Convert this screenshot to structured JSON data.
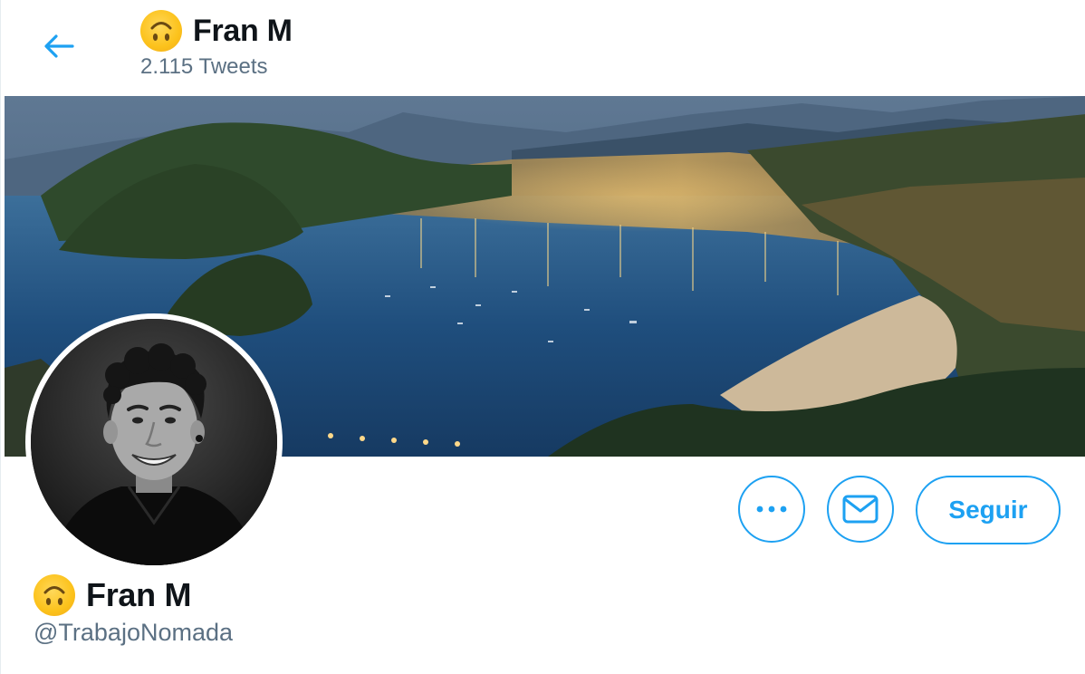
{
  "header": {
    "back_icon": "arrow-left-icon",
    "name": "Fran M",
    "tweet_count": "2.115 Tweets",
    "emoji_icon": "upside-down-face-emoji"
  },
  "banner": {
    "description_icon": "city-bay-night-photo"
  },
  "avatar": {
    "icon": "profile-photo"
  },
  "actions": {
    "more_icon": "more-dots-icon",
    "message_icon": "envelope-icon",
    "follow_label": "Seguir"
  },
  "profile": {
    "name": "Fran M",
    "handle": "@TrabajoNomada"
  },
  "colors": {
    "accent": "#1da1f2",
    "secondary_text": "#5b7083",
    "primary_text": "#0f1419"
  }
}
